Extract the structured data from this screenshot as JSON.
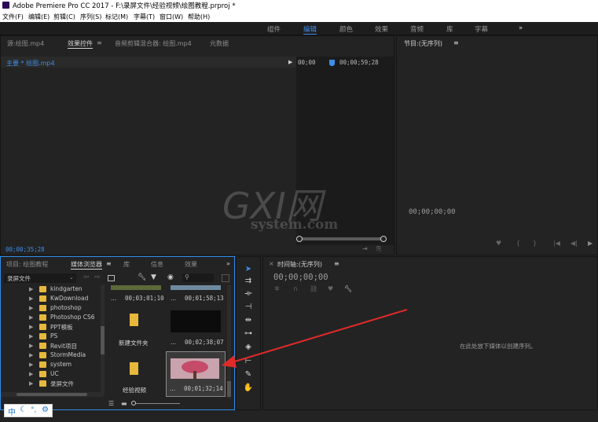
{
  "window": {
    "title": "Adobe Premiere Pro CC 2017 - F:\\录屏文件\\经验视频\\绘图教程.prproj *"
  },
  "menu": [
    "文件(F)",
    "编辑(E)",
    "剪辑(C)",
    "序列(S)",
    "标记(M)",
    "字幕(T)",
    "窗口(W)",
    "帮助(H)"
  ],
  "workspaces": [
    "组件",
    "编辑",
    "颜色",
    "效果",
    "音频",
    "库",
    "字幕",
    "»"
  ],
  "source_panel": {
    "tabs": [
      "源:绘图.mp4",
      "效果控件",
      "≡",
      "音频剪辑混合器: 绘图.mp4",
      "元数据"
    ],
    "clip": "主要 * 绘图.mp4",
    "tc_start": "00;00",
    "tc_end": "00;00;59;28",
    "timecode": "00;00;35;28"
  },
  "program_panel": {
    "title": "节目:(无序列)",
    "menu_icon": "≡",
    "timecode": "00;00;00;00"
  },
  "project_panel": {
    "tabs": [
      "项目: 绘图教程",
      "媒体浏览器",
      "≡",
      "库",
      "信息",
      "效果",
      "»"
    ],
    "location": "录屏文件",
    "tree": [
      "kindgarten",
      "KwDownload",
      "photoshop",
      "Photoshop CS6",
      "PPT模板",
      "PS",
      "Revit项目",
      "StormMedia",
      "system",
      "UC",
      "录屏文件"
    ],
    "thumbs": [
      {
        "label": "...",
        "duration": "00;03;01;10"
      },
      {
        "label": "...",
        "duration": "00;01;58;13"
      },
      {
        "label": "新建文件夹",
        "duration": ""
      },
      {
        "label": "...",
        "duration": "00;02;38;07"
      },
      {
        "label": "经验视频",
        "duration": ""
      },
      {
        "label": "...",
        "duration": "00;01;32;14"
      }
    ]
  },
  "timeline_panel": {
    "title": "时间轴:(无序列)",
    "menu_icon": "≡",
    "timecode": "00;00;00;00",
    "empty_msg": "在此处放下媒体以创建序列。"
  },
  "ime": {
    "label": "中"
  },
  "watermark": {
    "big": "GXI网",
    "small": "system.com"
  }
}
